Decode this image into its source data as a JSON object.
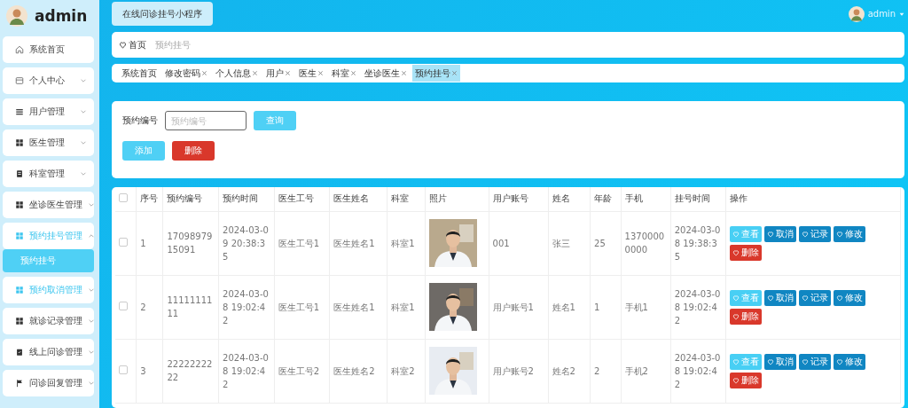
{
  "sidebar": {
    "title": "admin",
    "items": [
      {
        "label": "系统首页",
        "highlighted": false
      },
      {
        "label": "个人中心",
        "highlighted": false,
        "expanded": false
      },
      {
        "label": "用户管理",
        "highlighted": false,
        "expanded": false
      },
      {
        "label": "医生管理",
        "highlighted": false,
        "expanded": false
      },
      {
        "label": "科室管理",
        "highlighted": false,
        "expanded": false
      },
      {
        "label": "坐诊医生管理",
        "highlighted": false,
        "expanded": false
      },
      {
        "label": "预约挂号管理",
        "highlighted": true,
        "expanded": true,
        "children": [
          {
            "label": "预约挂号",
            "selected": true
          }
        ]
      },
      {
        "label": "预约取消管理",
        "highlighted": true,
        "expanded": false
      },
      {
        "label": "就诊记录管理",
        "highlighted": false,
        "expanded": false
      },
      {
        "label": "线上问诊管理",
        "highlighted": false,
        "expanded": false
      },
      {
        "label": "问诊回复管理",
        "highlighted": false,
        "expanded": false
      }
    ]
  },
  "header": {
    "app_button": "在线问诊挂号小程序",
    "user": "admin"
  },
  "breadcrumb": [
    "首页",
    "预约挂号"
  ],
  "tags": [
    {
      "label": "系统首页",
      "closable": false,
      "selected": false
    },
    {
      "label": "修改密码",
      "closable": true,
      "selected": false
    },
    {
      "label": "个人信息",
      "closable": true,
      "selected": false
    },
    {
      "label": "用户",
      "closable": true,
      "selected": false
    },
    {
      "label": "医生",
      "closable": true,
      "selected": false
    },
    {
      "label": "科室",
      "closable": true,
      "selected": false
    },
    {
      "label": "坐诊医生",
      "closable": true,
      "selected": false
    },
    {
      "label": "预约挂号",
      "closable": true,
      "selected": true
    }
  ],
  "search": {
    "label": "预约编号",
    "placeholder": "预约编号",
    "button": "查询",
    "actions": [
      {
        "label": "添加",
        "kind": "add"
      },
      {
        "label": "删除",
        "kind": "delete"
      }
    ]
  },
  "table": {
    "header_checked": false,
    "columns": [
      "序号",
      "预约编号",
      "预约时间",
      "医生工号",
      "医生姓名",
      "科室",
      "照片",
      "用户账号",
      "姓名",
      "年龄",
      "手机",
      "挂号时间",
      "操作"
    ],
    "rows": [
      {
        "checked": false,
        "cells": [
          "1",
          "1709897915091",
          "2024-03-09 20:38:35",
          "医生工号1",
          "医生姓名1",
          "科室1",
          {
            "kind": "picture"
          },
          "001",
          "张三",
          "25",
          "13700000000",
          "2024-03-08 19:38:35"
        ],
        "actions": [
          {
            "label": "查看",
            "kind": "view"
          },
          {
            "label": "取消",
            "kind": "primary"
          },
          {
            "label": "记录",
            "kind": "primary"
          },
          {
            "label": "修改",
            "kind": "primary"
          },
          {
            "label": "删除",
            "kind": "delete"
          }
        ]
      },
      {
        "checked": false,
        "cells": [
          "2",
          "1111111111",
          "2024-03-08 19:02:42",
          "医生工号1",
          "医生姓名1",
          "科室1",
          {
            "kind": "picture"
          },
          "用户账号1",
          "姓名1",
          "1",
          "手机1",
          "2024-03-08 19:02:42"
        ],
        "actions": [
          {
            "label": "查看",
            "kind": "view"
          },
          {
            "label": "取消",
            "kind": "primary"
          },
          {
            "label": "记录",
            "kind": "primary"
          },
          {
            "label": "修改",
            "kind": "primary"
          },
          {
            "label": "删除",
            "kind": "delete"
          }
        ]
      },
      {
        "checked": false,
        "cells": [
          "3",
          "2222222222",
          "2024-03-08 19:02:42",
          "医生工号2",
          "医生姓名2",
          "科室2",
          {
            "kind": "picture"
          },
          "用户账号2",
          "姓名2",
          "2",
          "手机2",
          "2024-03-08 19:02:42"
        ],
        "actions": [
          {
            "label": "查看",
            "kind": "view"
          },
          {
            "label": "取消",
            "kind": "primary"
          },
          {
            "label": "记录",
            "kind": "primary"
          },
          {
            "label": "修改",
            "kind": "primary"
          },
          {
            "label": "删除",
            "kind": "delete"
          }
        ]
      }
    ]
  }
}
